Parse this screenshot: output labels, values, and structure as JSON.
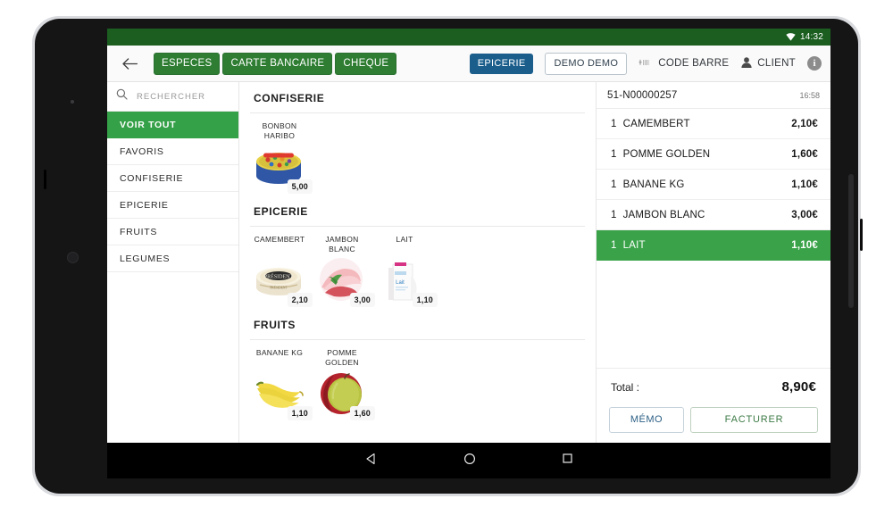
{
  "status_bar": {
    "time": "14:32",
    "wifi_icon": "wifi-icon"
  },
  "app_bar": {
    "back_icon": "back-arrow-icon",
    "payment_buttons": [
      {
        "label": "ESPECES"
      },
      {
        "label": "CARTE BANCAIRE"
      },
      {
        "label": "CHEQUE"
      }
    ],
    "store_badge": "EPICERIE",
    "user_badge": "DEMO DEMO",
    "barcode_label": "CODE BARRE",
    "barcode_icon": "barcode-icon",
    "client_label": "CLIENT",
    "client_icon": "person-icon",
    "info_icon": "info-icon",
    "info_glyph": "i"
  },
  "sidebar": {
    "search_placeholder": "RECHERCHER",
    "search_icon": "search-icon",
    "items": [
      {
        "label": "VOIR TOUT",
        "active": true
      },
      {
        "label": "FAVORIS",
        "active": false
      },
      {
        "label": "CONFISERIE",
        "active": false
      },
      {
        "label": "EPICERIE",
        "active": false
      },
      {
        "label": "FRUITS",
        "active": false
      },
      {
        "label": "LEGUMES",
        "active": false
      }
    ]
  },
  "catalog": {
    "sections": [
      {
        "title": "CONFISERIE",
        "products": [
          {
            "name": "BONBON HARIBO",
            "price": "5,00",
            "image": "haribo-candy-box"
          }
        ]
      },
      {
        "title": "EPICERIE",
        "products": [
          {
            "name": "CAMEMBERT",
            "price": "2,10",
            "image": "camembert-president"
          },
          {
            "name": "JAMBON BLANC",
            "price": "3,00",
            "image": "ham-slices"
          },
          {
            "name": "LAIT",
            "price": "1,10",
            "image": "milk-carton"
          }
        ]
      },
      {
        "title": "FRUITS",
        "products": [
          {
            "name": "BANANE KG",
            "price": "1,10",
            "image": "bananas"
          },
          {
            "name": "POMME GOLDEN",
            "price": "1,60",
            "image": "golden-apple"
          }
        ]
      }
    ]
  },
  "receipt": {
    "ticket_id": "51-N00000257",
    "time": "16:58",
    "items": [
      {
        "qty": "1",
        "name": "CAMEMBERT",
        "amount": "2,10€",
        "selected": false
      },
      {
        "qty": "1",
        "name": "POMME GOLDEN",
        "amount": "1,60€",
        "selected": false
      },
      {
        "qty": "1",
        "name": "BANANE KG",
        "amount": "1,10€",
        "selected": false
      },
      {
        "qty": "1",
        "name": "JAMBON BLANC",
        "amount": "3,00€",
        "selected": false
      },
      {
        "qty": "1",
        "name": "LAIT",
        "amount": "1,10€",
        "selected": true
      }
    ],
    "total_label": "Total :",
    "total_value": "8,90€",
    "memo_button": "MÉMO",
    "invoice_button": "FACTURER"
  },
  "nav_bar": {
    "back_icon": "triangle-back-icon",
    "home_icon": "circle-home-icon",
    "recents_icon": "square-recents-icon"
  },
  "colors": {
    "status_green": "#1b5e20",
    "payment_green": "#2e7d32",
    "active_green": "#34a047",
    "selected_green": "#3aa349",
    "store_blue": "#1b5e8c"
  }
}
